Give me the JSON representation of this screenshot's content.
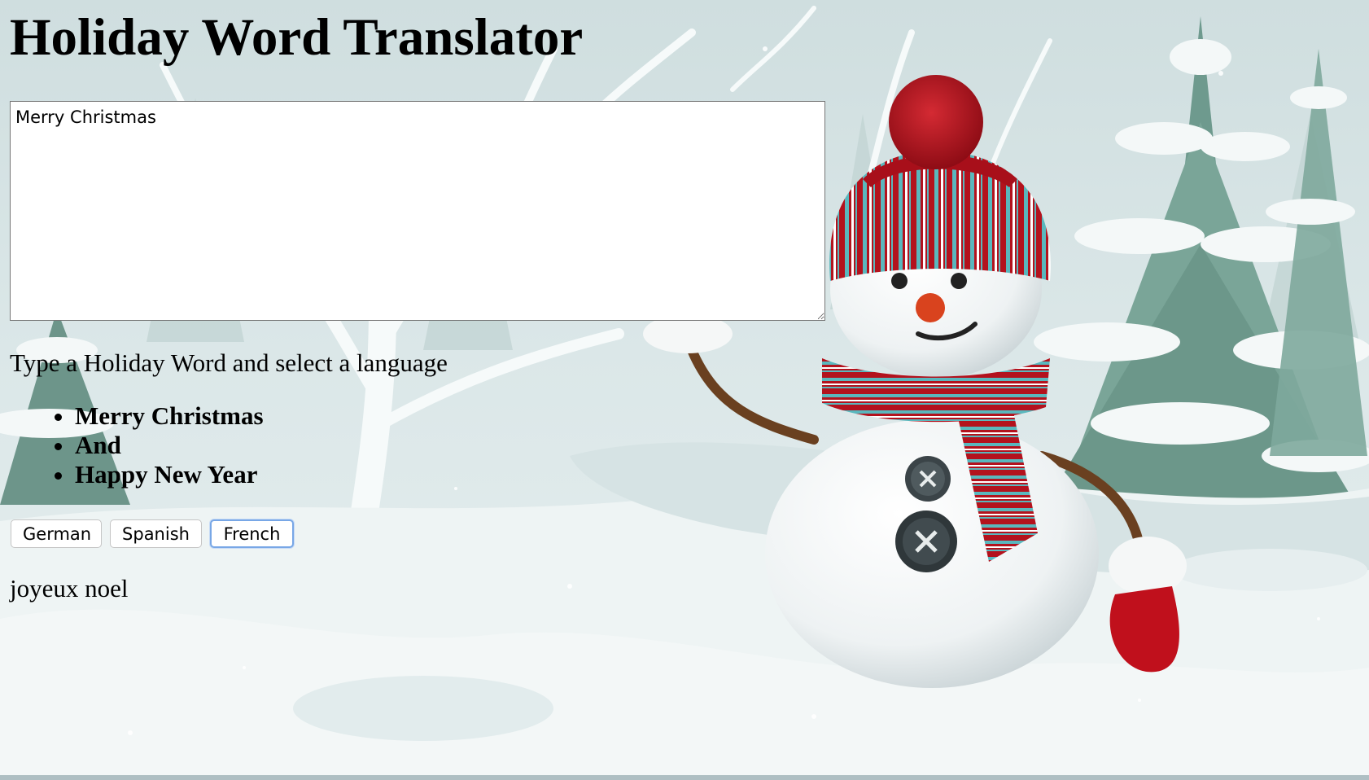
{
  "page": {
    "title": "Holiday Word Translator"
  },
  "input": {
    "value": "Merry Christmas"
  },
  "instructions": "Type a Holiday Word and select a language",
  "words": [
    "Merry Christmas",
    "And",
    "Happy New Year"
  ],
  "buttons": {
    "german": "German",
    "spanish": "Spanish",
    "french": "French",
    "focused": "French"
  },
  "result": "joyeux noel",
  "colors": {
    "background_snow": "#dfe9ea",
    "focus_ring": "#78a7e6",
    "snowman_hat_red": "#b3121d",
    "stripe_teal": "#5ab7bd"
  }
}
